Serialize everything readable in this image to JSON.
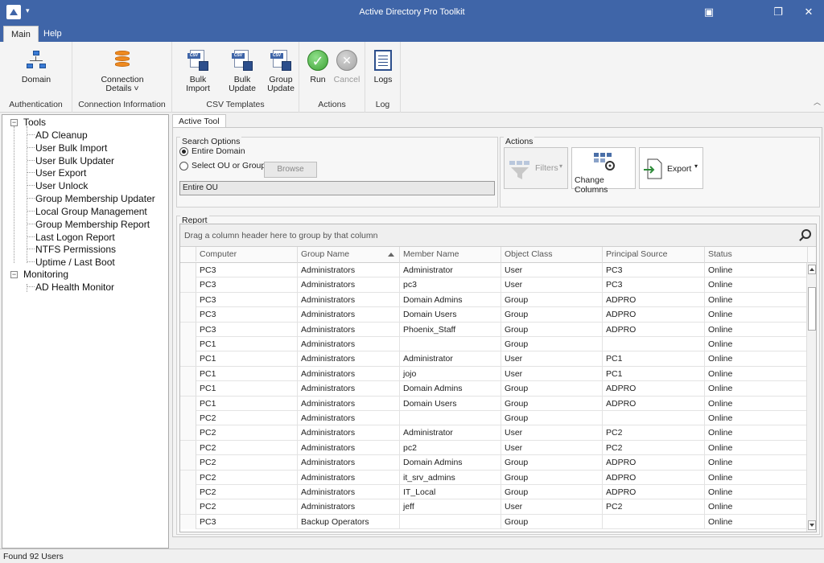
{
  "window": {
    "title": "Active Directory Pro Toolkit",
    "controls": {
      "pin": "▣",
      "restore": "❐",
      "close": "✕"
    },
    "qa_menu": "▾"
  },
  "menu_tabs": [
    "Main",
    "Help"
  ],
  "ribbon": {
    "groups": [
      {
        "label": "Authentication",
        "buttons": [
          {
            "label": "Domain",
            "icon": "domain-network-icon"
          }
        ]
      },
      {
        "label": "Connection Information",
        "buttons": [
          {
            "label": "Connection",
            "label2": "Details ˅",
            "icon": "database-icon"
          }
        ]
      },
      {
        "label": "CSV Templates",
        "buttons": [
          {
            "label": "Bulk Import",
            "icon": "csv-save-icon"
          },
          {
            "label": "Bulk Update",
            "icon": "csv-save-icon"
          },
          {
            "label": "Group",
            "label2": "Update",
            "icon": "csv-save-icon"
          }
        ]
      },
      {
        "label": "Actions",
        "buttons": [
          {
            "label": "Run",
            "icon": "check-icon"
          },
          {
            "label": "Cancel",
            "icon": "cancel-icon",
            "disabled": true
          }
        ]
      },
      {
        "label": "Log",
        "buttons": [
          {
            "label": "Logs",
            "icon": "log-document-icon"
          }
        ]
      }
    ],
    "collapse": "︿"
  },
  "tree": {
    "roots": [
      {
        "label": "Tools",
        "expander": "−",
        "children": [
          "AD Cleanup",
          "User Bulk Import",
          "User Bulk Updater",
          "User Export",
          "User Unlock",
          "Group Membership Updater",
          "Local Group Management",
          "Group Membership Report",
          "Last Logon Report",
          "NTFS Permissions",
          "Uptime / Last Boot"
        ]
      },
      {
        "label": "Monitoring",
        "expander": "−",
        "children": [
          "AD Health Monitor"
        ]
      }
    ]
  },
  "main": {
    "tab": "Active Tool",
    "search_options": {
      "title": "Search Options",
      "radio_entire_domain": "Entire Domain",
      "radio_select_ou": "Select OU or Group",
      "browse": "Browse",
      "ou_value": "Entire OU"
    },
    "actions": {
      "title": "Actions",
      "filters": "Filters",
      "change_columns": "Change Columns",
      "export": "Export",
      "dropdown_arrow": "▾"
    },
    "report": {
      "title": "Report",
      "group_panel_hint": "Drag a column header here to group by that column",
      "columns": [
        "Computer",
        "Group Name",
        "Member Name",
        "Object Class",
        "Principal Source",
        "Status"
      ],
      "sorted_column": "Group Name",
      "rows": [
        [
          "PC3",
          "Administrators",
          "Administrator",
          "User",
          "PC3",
          "Online"
        ],
        [
          "PC3",
          "Administrators",
          "pc3",
          "User",
          "PC3",
          "Online"
        ],
        [
          "PC3",
          "Administrators",
          "Domain Admins",
          "Group",
          "ADPRO",
          "Online"
        ],
        [
          "PC3",
          "Administrators",
          "Domain Users",
          "Group",
          "ADPRO",
          "Online"
        ],
        [
          "PC3",
          "Administrators",
          "Phoenix_Staff",
          "Group",
          "ADPRO",
          "Online"
        ],
        [
          "PC1",
          "Administrators",
          "",
          "Group",
          "",
          "Online"
        ],
        [
          "PC1",
          "Administrators",
          "Administrator",
          "User",
          "PC1",
          "Online"
        ],
        [
          "PC1",
          "Administrators",
          "jojo",
          "User",
          "PC1",
          "Online"
        ],
        [
          "PC1",
          "Administrators",
          "Domain Admins",
          "Group",
          "ADPRO",
          "Online"
        ],
        [
          "PC1",
          "Administrators",
          "Domain Users",
          "Group",
          "ADPRO",
          "Online"
        ],
        [
          "PC2",
          "Administrators",
          "",
          "Group",
          "",
          "Online"
        ],
        [
          "PC2",
          "Administrators",
          "Administrator",
          "User",
          "PC2",
          "Online"
        ],
        [
          "PC2",
          "Administrators",
          "pc2",
          "User",
          "PC2",
          "Online"
        ],
        [
          "PC2",
          "Administrators",
          "Domain Admins",
          "Group",
          "ADPRO",
          "Online"
        ],
        [
          "PC2",
          "Administrators",
          "it_srv_admins",
          "Group",
          "ADPRO",
          "Online"
        ],
        [
          "PC2",
          "Administrators",
          "IT_Local",
          "Group",
          "ADPRO",
          "Online"
        ],
        [
          "PC2",
          "Administrators",
          "jeff",
          "User",
          "PC2",
          "Online"
        ],
        [
          "PC3",
          "Backup Operators",
          "",
          "Group",
          "",
          "Online"
        ]
      ]
    }
  },
  "status_bar": "Found 92 Users",
  "colors": {
    "titlebar": "#3f65a8",
    "accent": "#3f65a8"
  }
}
